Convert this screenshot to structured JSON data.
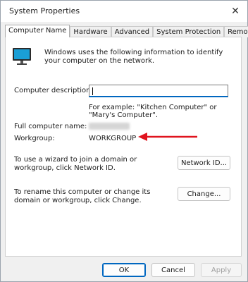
{
  "window": {
    "title": "System Properties",
    "close_glyph": "✕"
  },
  "tabs": [
    {
      "label": "Computer Name",
      "active": true
    },
    {
      "label": "Hardware",
      "active": false
    },
    {
      "label": "Advanced",
      "active": false
    },
    {
      "label": "System Protection",
      "active": false
    },
    {
      "label": "Remote",
      "active": false
    }
  ],
  "computer_name_tab": {
    "icon": "monitor-icon",
    "info_text": "Windows uses the following information to identify your computer on the network.",
    "description_label": "Computer description:",
    "description_value": "",
    "example_text": "For example: \"Kitchen Computer\" or \"Mary's Computer\".",
    "full_name_label": "Full computer name:",
    "workgroup_label": "Workgroup:",
    "workgroup_value": "WORKGROUP",
    "network_id_text": "To use a wizard to join a domain or workgroup, click Network ID.",
    "network_id_button": "Network ID...",
    "change_text": "To rename this computer or change its domain or workgroup, click Change.",
    "change_button": "Change..."
  },
  "footer": {
    "ok": "OK",
    "cancel": "Cancel",
    "apply": "Apply"
  },
  "colors": {
    "accent": "#0067c0",
    "annotation_arrow": "#e0141e",
    "monitor_screen": "#1a9fd6"
  }
}
